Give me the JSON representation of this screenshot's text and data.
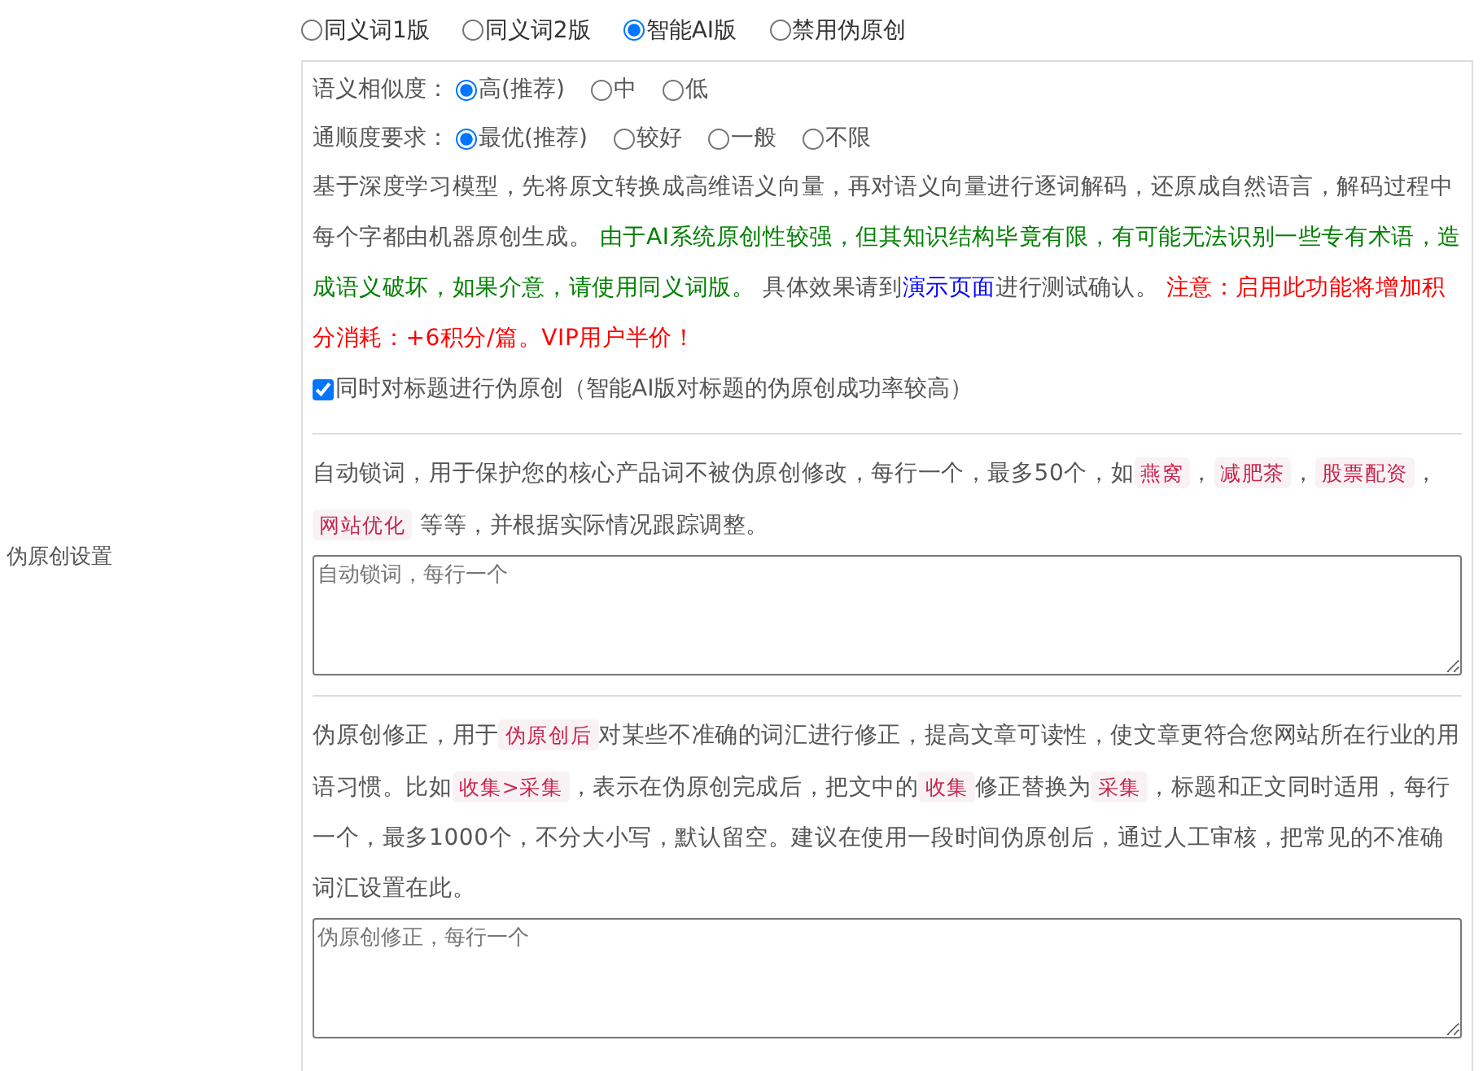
{
  "mode_options": [
    {
      "label": "同义词1版",
      "selected": false
    },
    {
      "label": "同义词2版",
      "selected": false
    },
    {
      "label": "智能AI版",
      "selected": true
    },
    {
      "label": "禁用伪原创",
      "selected": false
    }
  ],
  "section_label": "伪原创设置",
  "similarity": {
    "label": "语义相似度：",
    "options": [
      {
        "label": "高(推荐)",
        "selected": true
      },
      {
        "label": "中",
        "selected": false
      },
      {
        "label": "低",
        "selected": false
      }
    ]
  },
  "fluency": {
    "label": "通顺度要求：",
    "options": [
      {
        "label": "最优(推荐)",
        "selected": true
      },
      {
        "label": "较好",
        "selected": false
      },
      {
        "label": "一般",
        "selected": false
      },
      {
        "label": "不限",
        "selected": false
      }
    ]
  },
  "ai_description": [
    {
      "kind": "text",
      "text": "基于深度学习模型，先将原文转换成高维语义向量，再对语义向量进行逐词解码，还原成自然语言，解码过程中每个字都由机器原创生成。 "
    },
    {
      "kind": "green",
      "text": "由于AI系统原创性较强，但其知识结构毕竟有限，有可能无法识别一些专有术语，造成语义破坏，如果介意，请使用同义词版。"
    },
    {
      "kind": "text",
      "text": " 具体效果请到"
    },
    {
      "kind": "link",
      "text": "演示页面"
    },
    {
      "kind": "text",
      "text": "进行测试确认。 "
    },
    {
      "kind": "red",
      "text": "注意：启用此功能将增加积分消耗：+6积分/篇。VIP用户半价！"
    }
  ],
  "title_option": {
    "label": "同时对标题进行伪原创（智能AI版对标题的伪原创成功率较高）",
    "checked": true
  },
  "lock_words": {
    "description": [
      {
        "kind": "text",
        "text": "自动锁词，用于保护您的核心产品词不被伪原创修改，每行一个，最多50个，如"
      },
      {
        "kind": "tag",
        "text": "燕窝"
      },
      {
        "kind": "text",
        "text": "，"
      },
      {
        "kind": "tag",
        "text": "减肥茶"
      },
      {
        "kind": "text",
        "text": "，"
      },
      {
        "kind": "tag",
        "text": "股票配资"
      },
      {
        "kind": "text",
        "text": "，"
      },
      {
        "kind": "tag",
        "text": "网站优化"
      },
      {
        "kind": "text",
        "text": " 等等，并根据实际情况跟踪调整。"
      }
    ],
    "placeholder": "自动锁词，每行一个"
  },
  "correction": {
    "description": [
      {
        "kind": "text",
        "text": "伪原创修正，用于"
      },
      {
        "kind": "tag",
        "text": "伪原创后"
      },
      {
        "kind": "text",
        "text": "对某些不准确的词汇进行修正，提高文章可读性，使文章更符合您网站所在行业的用语习惯。比如"
      },
      {
        "kind": "tag",
        "text": "收集>采集"
      },
      {
        "kind": "text",
        "text": "，表示在伪原创完成后，把文中的"
      },
      {
        "kind": "tag",
        "text": "收集"
      },
      {
        "kind": "text",
        "text": "修正替换为"
      },
      {
        "kind": "tag",
        "text": "采集"
      },
      {
        "kind": "text",
        "text": "，标题和正文同时适用，每行一个，最多1000个，不分大小写，默认留空。建议在使用一段时间伪原创后，通过人工审核，把常见的不准确词汇设置在此。"
      }
    ],
    "placeholder": "伪原创修正，每行一个"
  }
}
